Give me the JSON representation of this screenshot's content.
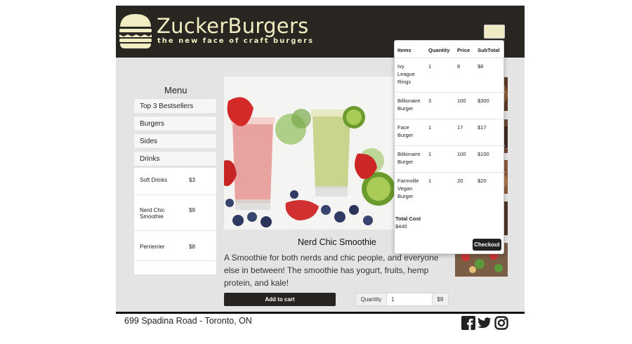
{
  "header": {
    "brand": "ZuckerBurgers",
    "tagline": "the new face of craft burgers",
    "menu_button_icon": "hamburger-menu-icon",
    "logo_icon": "burger-icon"
  },
  "sidebar": {
    "title": "Menu",
    "items": [
      {
        "label": "Top 3 Bestsellers"
      },
      {
        "label": "Burgers"
      },
      {
        "label": "Sides"
      },
      {
        "label": "Drinks"
      }
    ],
    "drinks": [
      {
        "name": "Soft Drinks",
        "price": "$3"
      },
      {
        "name": "Nerd Chic Smoothie",
        "price": "$9"
      },
      {
        "name": "Perrierrier",
        "price": "$8"
      }
    ]
  },
  "product": {
    "name": "Nerd Chic Smoothie",
    "description": "A Smoothie for both nerds and chic people, and everyone else in between! The smoothie has yogurt, fruits, hemp protein, and kale!",
    "add_to_cart_label": "Add to cart",
    "quantity_label": "Quantity",
    "quantity_value": "1",
    "price": "$9"
  },
  "cart": {
    "headers": {
      "items": "Items",
      "quantity": "Quantity",
      "price": "Price",
      "subtotal": "SubTotal"
    },
    "rows": [
      {
        "item": "Ivy League Rings",
        "quantity": "1",
        "price": "8",
        "subtotal": "$8"
      },
      {
        "item": "Billionaire Burger",
        "quantity": "3",
        "price": "100",
        "subtotal": "$300"
      },
      {
        "item": "Face Burger",
        "quantity": "1",
        "price": "17",
        "subtotal": "$17"
      },
      {
        "item": "Billionaire Burger",
        "quantity": "1",
        "price": "100",
        "subtotal": "$100"
      },
      {
        "item": "Farmville Vegan Burger",
        "quantity": "1",
        "price": "20",
        "subtotal": "$20"
      }
    ],
    "total_label": "Total Cost",
    "total_value": "$445",
    "checkout_label": "Checkout"
  },
  "footer": {
    "address": "699 Spadina Road - Toronto, ON",
    "social_icons": [
      "facebook-icon",
      "twitter-icon",
      "instagram-icon"
    ]
  },
  "colors": {
    "header_bg": "#292622",
    "brand_text": "#f1ecc2",
    "button_dark": "#262320"
  }
}
